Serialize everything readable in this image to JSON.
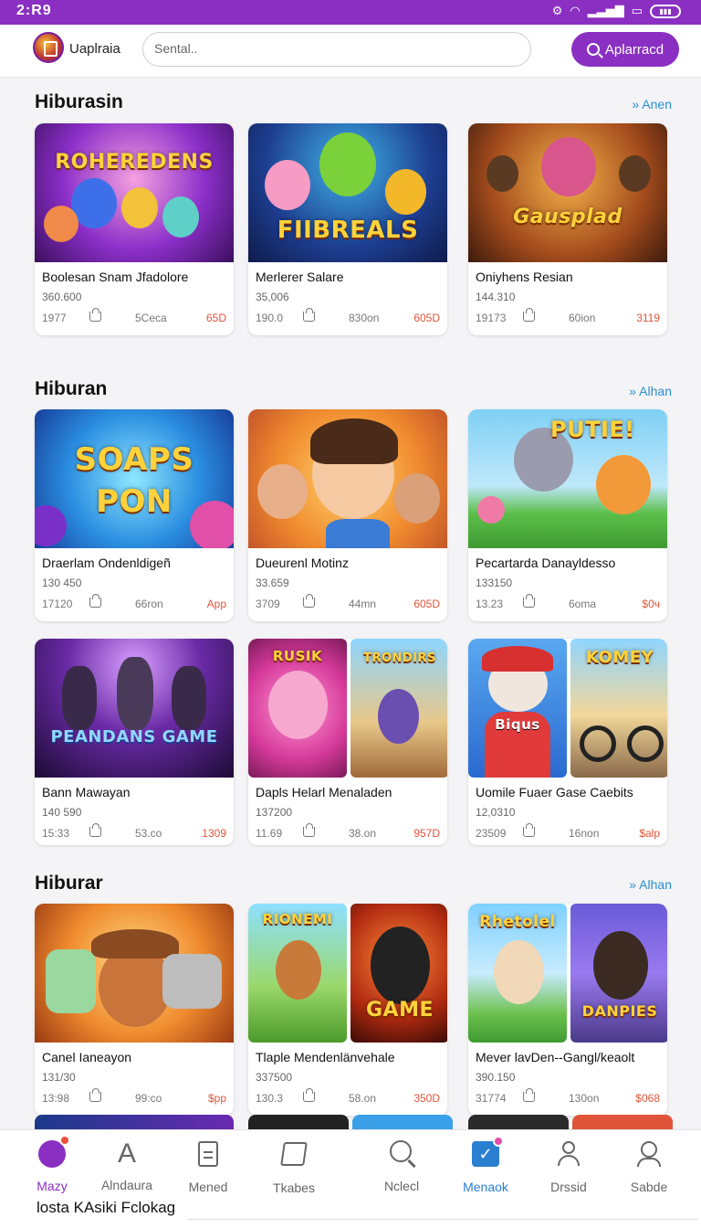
{
  "status": {
    "time": "2:R9"
  },
  "header": {
    "app_name": "Uaplraia",
    "search_placeholder": "Sental..",
    "apply_label": "Aplarracd"
  },
  "sections": [
    {
      "title": "Hiburasin",
      "see_all": "» Anen",
      "cards": [
        {
          "title": "Boolesan Snam Jfadolore",
          "sub": "360.600",
          "a": "1977",
          "b": "5Ceca",
          "c": "65D",
          "art": "ROHEREDENS"
        },
        {
          "title": "Merlerer Salare",
          "sub": "35,006",
          "a": "190.0",
          "b": "830on",
          "c": "605D",
          "art": "FIIBREALS"
        },
        {
          "title": "Oniyhens Resian",
          "sub": "144.310",
          "a": "19173",
          "b": "60ion",
          "c": "3119",
          "art": "Gausplad"
        }
      ]
    },
    {
      "title": "Hiburan",
      "see_all": "» Alhan",
      "cards": [
        {
          "title": "Draerlam Ondenldigeñ",
          "sub": "130 450",
          "a": "17120",
          "b": "66ron",
          "c": "App",
          "art": "SOAPS PON"
        },
        {
          "title": "Dueurenl Motinz",
          "sub": "33.659",
          "a": "3709",
          "b": "44mn",
          "c": "605D",
          "art": ""
        },
        {
          "title": "Pecartarda Danayldesso",
          "sub": "133150",
          "a": "13.23",
          "b": "6oma",
          "c": "$0ч",
          "art": "PUTIE!"
        },
        {
          "title": "Bann Mawayan",
          "sub": "140 590",
          "a": "15:33",
          "b": "53.co",
          "c": "1309",
          "art": "PEANDANS GAME"
        },
        {
          "title": "Dapls Helarl Menaladen",
          "sub": "137200",
          "a": "11.69",
          "b": "38.on",
          "c": "957D",
          "art": "RUSIK",
          "art2": "TRONDIRS"
        },
        {
          "title": "Uomile Fuaer Gase Caebits",
          "sub": "12,0310",
          "a": "23509",
          "b": "16non",
          "c": "$alp",
          "art": "Biqus",
          "art2": "KOMEY"
        }
      ]
    },
    {
      "title": "Hiburar",
      "see_all": "» Alhan",
      "cards": [
        {
          "title": "Canel Ianeayon",
          "sub": "131/30",
          "a": "13:98",
          "b": "99:co",
          "c": "$pp",
          "art": ""
        },
        {
          "title": "Tlaple Mendenlänvehale",
          "sub": "337500",
          "a": "130.3",
          "b": "58.on",
          "c": "350D",
          "art": "RIONEMI",
          "art2": "GAME"
        },
        {
          "title": "Mever lavDen--Gangl/keaolt",
          "sub": "390.150",
          "a": "31774",
          "b": "130on",
          "c": "$068",
          "art": "Rhetolel",
          "art2": "DANPIES"
        }
      ]
    }
  ],
  "nav": [
    {
      "label": "Mazy"
    },
    {
      "label": "Alndaura"
    },
    {
      "label": "Mened"
    },
    {
      "label": "Tkabes"
    },
    {
      "label": "Nclecl"
    },
    {
      "label": "Menaok"
    },
    {
      "label": "Drssid"
    },
    {
      "label": "Sabde"
    }
  ],
  "footer_text": "losta KAsiki Fclokag",
  "colors": {
    "accent": "#8a2fc2",
    "link": "#2a8fd4",
    "price": "#e0553a"
  }
}
